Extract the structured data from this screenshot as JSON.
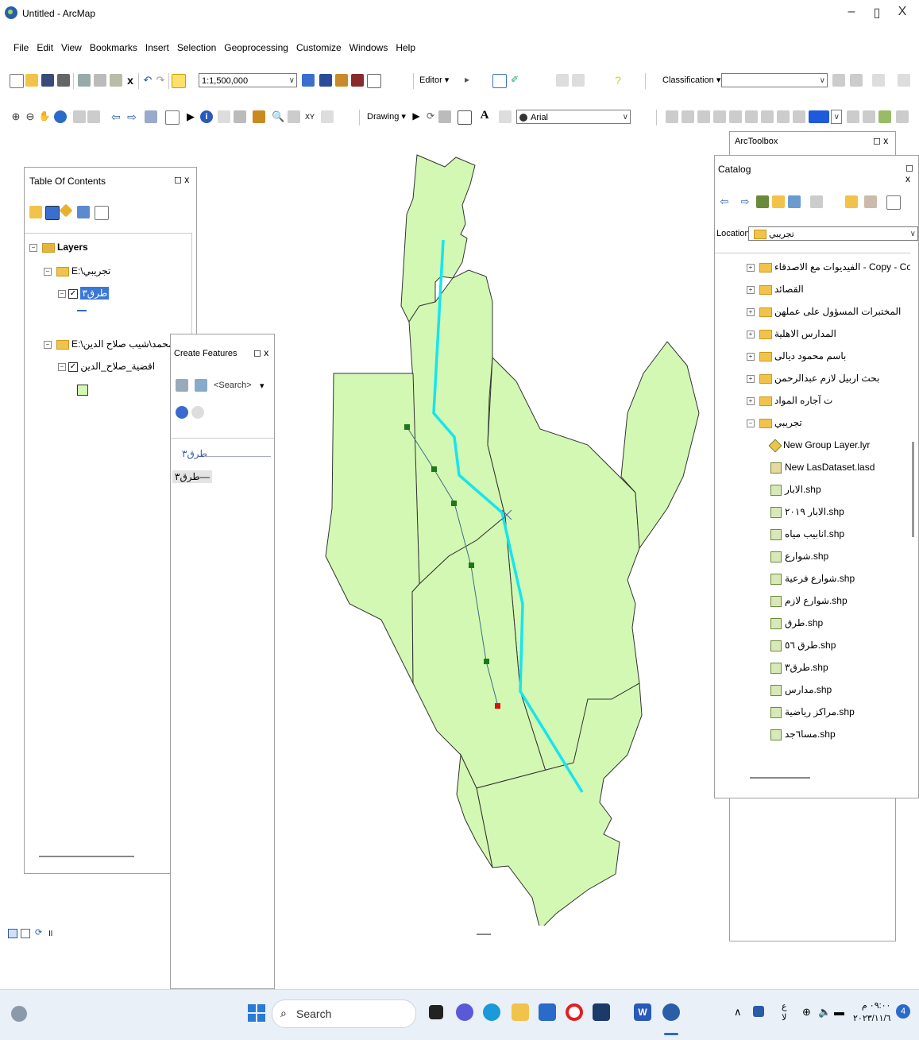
{
  "window": {
    "title": "Untitled - ArcMap",
    "controls": [
      "–",
      "▯",
      "X"
    ]
  },
  "menu": [
    "File",
    "Edit",
    "View",
    "Bookmarks",
    "Insert",
    "Selection",
    "Geoprocessing",
    "Customize",
    "Windows",
    "Help"
  ],
  "toolbar": {
    "scale": "1:1,500,000",
    "editor_label": "Editor",
    "classification_label": "Classification",
    "drawing_label": "Drawing",
    "font_name": "Arial",
    "font_icon_label": "A"
  },
  "toc": {
    "title": "Table Of Contents",
    "root_label": "Layers",
    "group1": "E:\\تجريبي",
    "group1_layer": "طرق٣",
    "group2": "E:\\لازم محمد\\شيب صلاح الدين",
    "group2_layer": "اقضية_صلاح_الدين"
  },
  "create_features": {
    "title": "Create Features",
    "search_placeholder": "<Search>",
    "template_group": "طرق٣",
    "template_item": "طرق٣"
  },
  "toolbox": {
    "title": "ArcToolbox"
  },
  "catalog": {
    "title": "Catalog",
    "location_label": "Location:",
    "location_value": "تجريبي",
    "items": [
      {
        "label": "الفيديوات مع الاصدقاء - Copy - Copy",
        "kind": "folder"
      },
      {
        "label": "القصائد",
        "kind": "folder"
      },
      {
        "label": "المختبرات المسؤول على عملهن",
        "kind": "folder"
      },
      {
        "label": "المدارس الاهلية",
        "kind": "folder"
      },
      {
        "label": "باسم محمود ديالى",
        "kind": "folder"
      },
      {
        "label": "بحث اربيل لازم عبدالرحمن",
        "kind": "folder"
      },
      {
        "label": "ت آجاره المواد",
        "kind": "folder"
      },
      {
        "label": "تجريبي",
        "kind": "folder-open"
      },
      {
        "label": "New Group Layer.lyr",
        "kind": "file"
      },
      {
        "label": "New LasDataset.lasd",
        "kind": "file"
      },
      {
        "label": "الابار.shp",
        "kind": "file"
      },
      {
        "label": "الابار ٢٠١٩.shp",
        "kind": "file"
      },
      {
        "label": "انابيب مياه.shp",
        "kind": "file"
      },
      {
        "label": "شوارع.shp",
        "kind": "file"
      },
      {
        "label": "شوارع فرعية.shp",
        "kind": "file"
      },
      {
        "label": "شوارع لازم.shp",
        "kind": "file"
      },
      {
        "label": "طرق.shp",
        "kind": "file"
      },
      {
        "label": "طرق ٥٦.shp",
        "kind": "file"
      },
      {
        "label": "طرق٣.shp",
        "kind": "file"
      },
      {
        "label": "مدارس.shp",
        "kind": "file"
      },
      {
        "label": "مراكز رياضية.shp",
        "kind": "file"
      },
      {
        "label": "مسا٦جد.shp",
        "kind": "file"
      }
    ]
  },
  "taskbar": {
    "search": "Search",
    "time": "٠٩:٠٠ م",
    "date": "٢٠٢٣/١١/٦",
    "lang_top": "ع",
    "lang_bottom": "ﻻ",
    "notification_count": "4"
  }
}
